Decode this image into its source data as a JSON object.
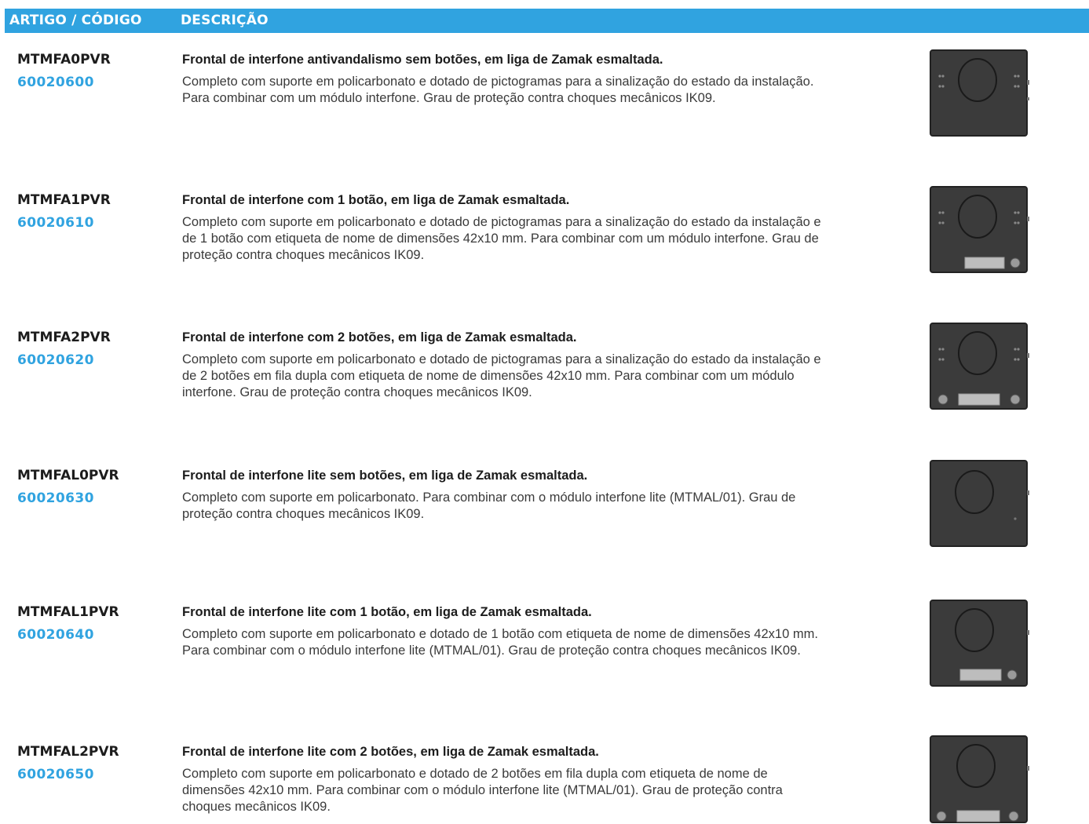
{
  "header": {
    "col1": "ARTIGO / CÓDIGO",
    "col2": "DESCRIÇÃO"
  },
  "products": [
    {
      "code": "MTMFA0PVR",
      "number": "60020600",
      "title": "Frontal de interfone antivandalismo sem botões, em liga de Zamak esmaltada.",
      "description": "Completo com suporte em policarbonato e dotado de pictogramas para a sinalização do estado da instalação. Para combinar com um módulo interfone. Grau de proteção contra choques mecânicos IK09.",
      "image": "Frontal de interfone sem botões"
    },
    {
      "code": "MTMFA1PVR",
      "number": "60020610",
      "title": "Frontal de interfone com 1 botão, em liga de Zamak esmaltada.",
      "description": "Completo com suporte em policarbonato e dotado de pictogramas para a sinalização do estado da instalação e de 1 botão com etiqueta de nome de dimensões 42x10 mm. Para combinar com um módulo interfone. Grau de proteção contra choques mecânicos IK09.",
      "image": "Frontal de interfone com 1 botão"
    },
    {
      "code": "MTMFA2PVR",
      "number": "60020620",
      "title": "Frontal de interfone com 2 botões, em liga de Zamak esmaltada.",
      "description": "Completo com suporte em policarbonato e dotado de pictogramas para a sinalização do estado da instalação e de 2 botões em fila dupla com etiqueta de nome de dimensões 42x10 mm. Para combinar com um módulo interfone. Grau de proteção contra choques mecânicos IK09.",
      "image": "Frontal de interfone com 2 botões"
    },
    {
      "code": "MTMFAL0PVR",
      "number": "60020630",
      "title": "Frontal de interfone lite sem botões, em liga de Zamak esmaltada.",
      "description": "Completo com suporte em policarbonato. Para combinar com o módulo interfone lite (MTMAL/01). Grau de proteção contra choques mecânicos IK09.",
      "image": "Frontal de interfone lite sem botões"
    },
    {
      "code": "MTMFAL1PVR",
      "number": "60020640",
      "title": "Frontal de interfone lite com 1 botão, em liga de Zamak esmaltada.",
      "description": "Completo com suporte em policarbonato e dotado de 1 botão com etiqueta de nome de dimensões 42x10 mm. Para combinar com o módulo interfone lite (MTMAL/01). Grau de proteção contra choques mecânicos IK09.",
      "image": "Frontal de interfone lite com 1 botão"
    },
    {
      "code": "MTMFAL2PVR",
      "number": "60020650",
      "title": "Frontal de interfone lite com 2 botões, em liga de Zamak esmaltada.",
      "description": "Completo com suporte em policarbonato e dotado de 2 botões em fila dupla com etiqueta de nome de dimensões 42x10 mm. Para combinar com o módulo interfone lite (MTMAL/01). Grau de proteção contra choques mecânicos IK09.",
      "image": "Frontal de interfone lite com 2 botões"
    }
  ],
  "colors": {
    "accent": "#30a3e0",
    "text": "#1c1c1c",
    "panel": "#3b3b3b"
  }
}
